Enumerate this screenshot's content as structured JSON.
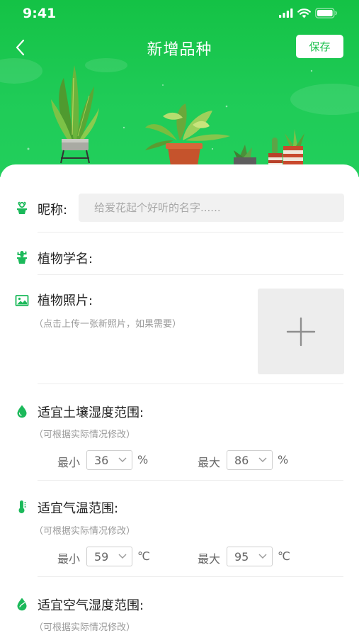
{
  "status_bar": {
    "time": "9:41"
  },
  "nav": {
    "title": "新增品种",
    "save_label": "保存"
  },
  "form": {
    "nickname": {
      "label": "昵称:",
      "placeholder": "给爱花起个好听的名字......",
      "value": ""
    },
    "scientific_name": {
      "label": "植物学名:"
    },
    "photo": {
      "label": "植物照片:",
      "hint": "（点击上传一张新照片，如果需要）"
    },
    "soil_humidity": {
      "label": "适宜土壤湿度范围:",
      "hint": "（可根据实际情况修改）",
      "min_label": "最小",
      "min_value": "36",
      "max_label": "最大",
      "max_value": "86",
      "unit": "%"
    },
    "temperature": {
      "label": "适宜气温范围:",
      "hint": "（可根据实际情况修改）",
      "min_label": "最小",
      "min_value": "59",
      "max_label": "最大",
      "max_value": "95",
      "unit": "℃"
    },
    "air_humidity": {
      "label": "适宜空气湿度范围:",
      "hint": "（可根据实际情况修改）"
    }
  },
  "colors": {
    "brand_green": "#1fc651",
    "icon_green": "#1bb95a"
  }
}
